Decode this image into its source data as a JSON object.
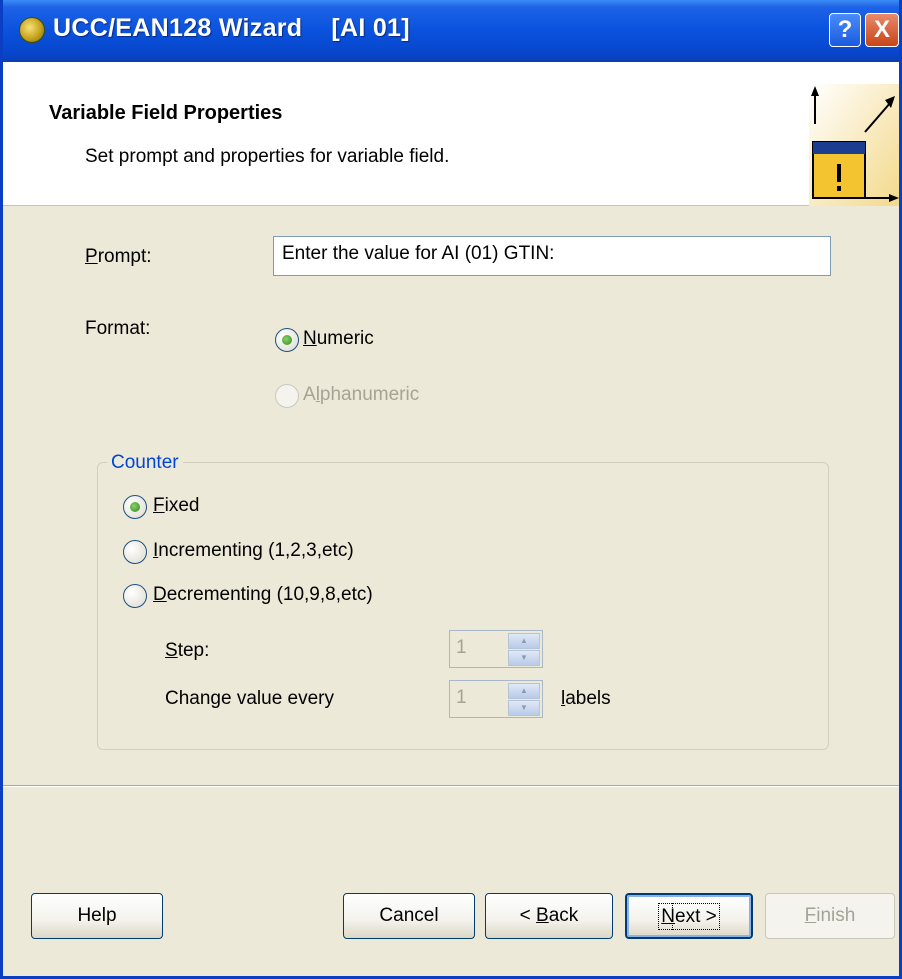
{
  "window": {
    "title": "UCC/EAN128 Wizard    [AI 01]",
    "help_button": "?",
    "close_button": "X"
  },
  "header": {
    "title": "Variable Field Properties",
    "subtitle": "Set prompt and properties for variable field.",
    "icon": "wizard-warning-icon"
  },
  "prompt": {
    "label_underlined": "P",
    "label_rest": "rompt:",
    "value": "Enter the value for AI (01) GTIN:"
  },
  "format": {
    "label": "Format:",
    "options": [
      {
        "underlined": "N",
        "rest": "umeric",
        "checked": true,
        "enabled": true
      },
      {
        "prefix": "A",
        "underlined": "l",
        "rest": "phanumeric",
        "checked": false,
        "enabled": false
      }
    ]
  },
  "counter": {
    "title": "Counter",
    "options": [
      {
        "underlined": "F",
        "rest": "ixed",
        "checked": true
      },
      {
        "underlined": "I",
        "rest": "ncrementing (1,2,3,etc)",
        "checked": false
      },
      {
        "underlined": "D",
        "rest": "ecrementing (10,9,8,etc)",
        "checked": false
      }
    ],
    "step": {
      "label_underlined": "S",
      "label_rest": "tep:",
      "value": "1"
    },
    "change_every": {
      "label": "Change value every",
      "value": "1",
      "suffix_underlined": "l",
      "suffix_rest": "abels"
    }
  },
  "buttons": {
    "help": "Help",
    "cancel": "Cancel",
    "back_prefix": "< ",
    "back_underlined": "B",
    "back_rest": "ack",
    "next_underlined": "N",
    "next_rest": "ext >",
    "finish_underlined": "F",
    "finish_rest": "inish"
  },
  "colors": {
    "title_bar": "#0a52dd",
    "dialog_bg": "#ece9d8",
    "group_title": "#0046d5",
    "radio_dot": "#2b8a1d"
  }
}
